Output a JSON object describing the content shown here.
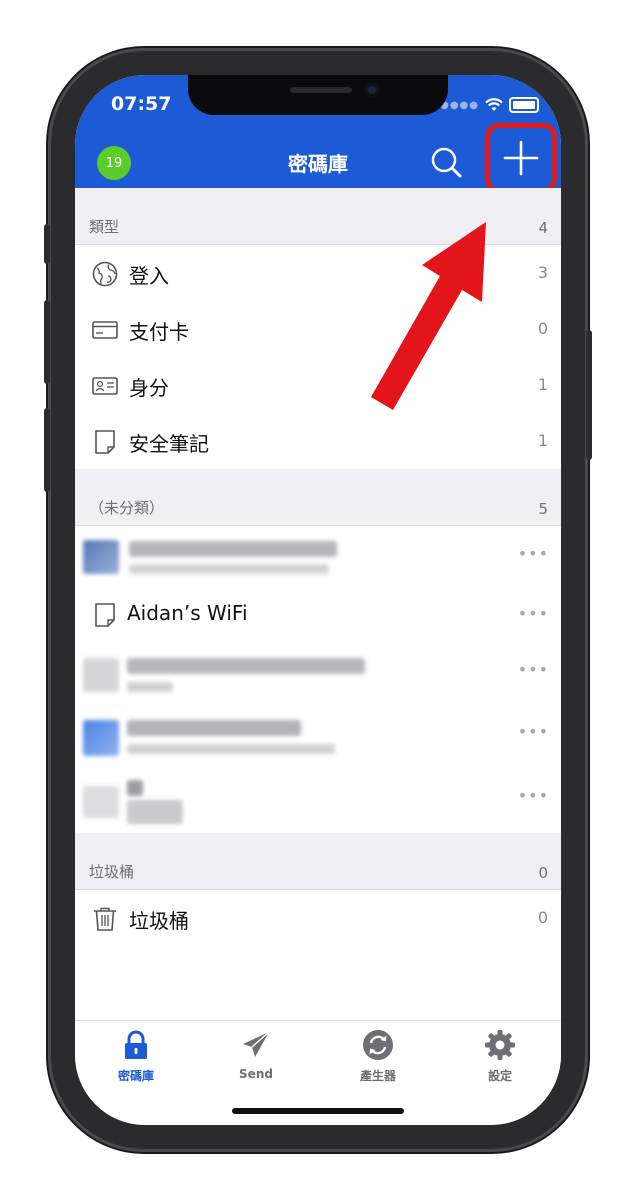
{
  "status_bar": {
    "time": "07:57"
  },
  "header": {
    "avatar_initials": "19",
    "title": "密碼庫"
  },
  "sections": {
    "types": {
      "label": "類型",
      "count": "4",
      "items": [
        {
          "label": "登入",
          "count": "3",
          "icon": "globe-icon"
        },
        {
          "label": "支付卡",
          "count": "0",
          "icon": "card-icon"
        },
        {
          "label": "身分",
          "count": "1",
          "icon": "id-card-icon"
        },
        {
          "label": "安全筆記",
          "count": "1",
          "icon": "note-icon"
        }
      ]
    },
    "uncategorized": {
      "label": "（未分類）",
      "count": "5",
      "items": [
        {
          "label": "",
          "blurred": true
        },
        {
          "label": "Aidan’s WiFi",
          "blurred": false
        },
        {
          "label": "",
          "blurred": true
        },
        {
          "label": "",
          "blurred": true
        },
        {
          "label": "",
          "blurred": true
        }
      ],
      "more_label": "•••"
    },
    "trash": {
      "label": "垃圾桶",
      "count": "0",
      "items": [
        {
          "label": "垃圾桶",
          "count": "0",
          "icon": "trash-icon"
        }
      ]
    }
  },
  "tabbar": {
    "tabs": [
      {
        "label": "密碼庫",
        "active": true,
        "icon": "lock-icon"
      },
      {
        "label": "Send",
        "active": false,
        "icon": "paper-plane-icon"
      },
      {
        "label": "產生器",
        "active": false,
        "icon": "refresh-icon"
      },
      {
        "label": "設定",
        "active": false,
        "icon": "gear-icon"
      }
    ]
  },
  "colors": {
    "header": "#1d5bd6",
    "accent": "#1d5bd6",
    "annotation": "#e01b1b",
    "avatar": "#5ccc2b"
  }
}
